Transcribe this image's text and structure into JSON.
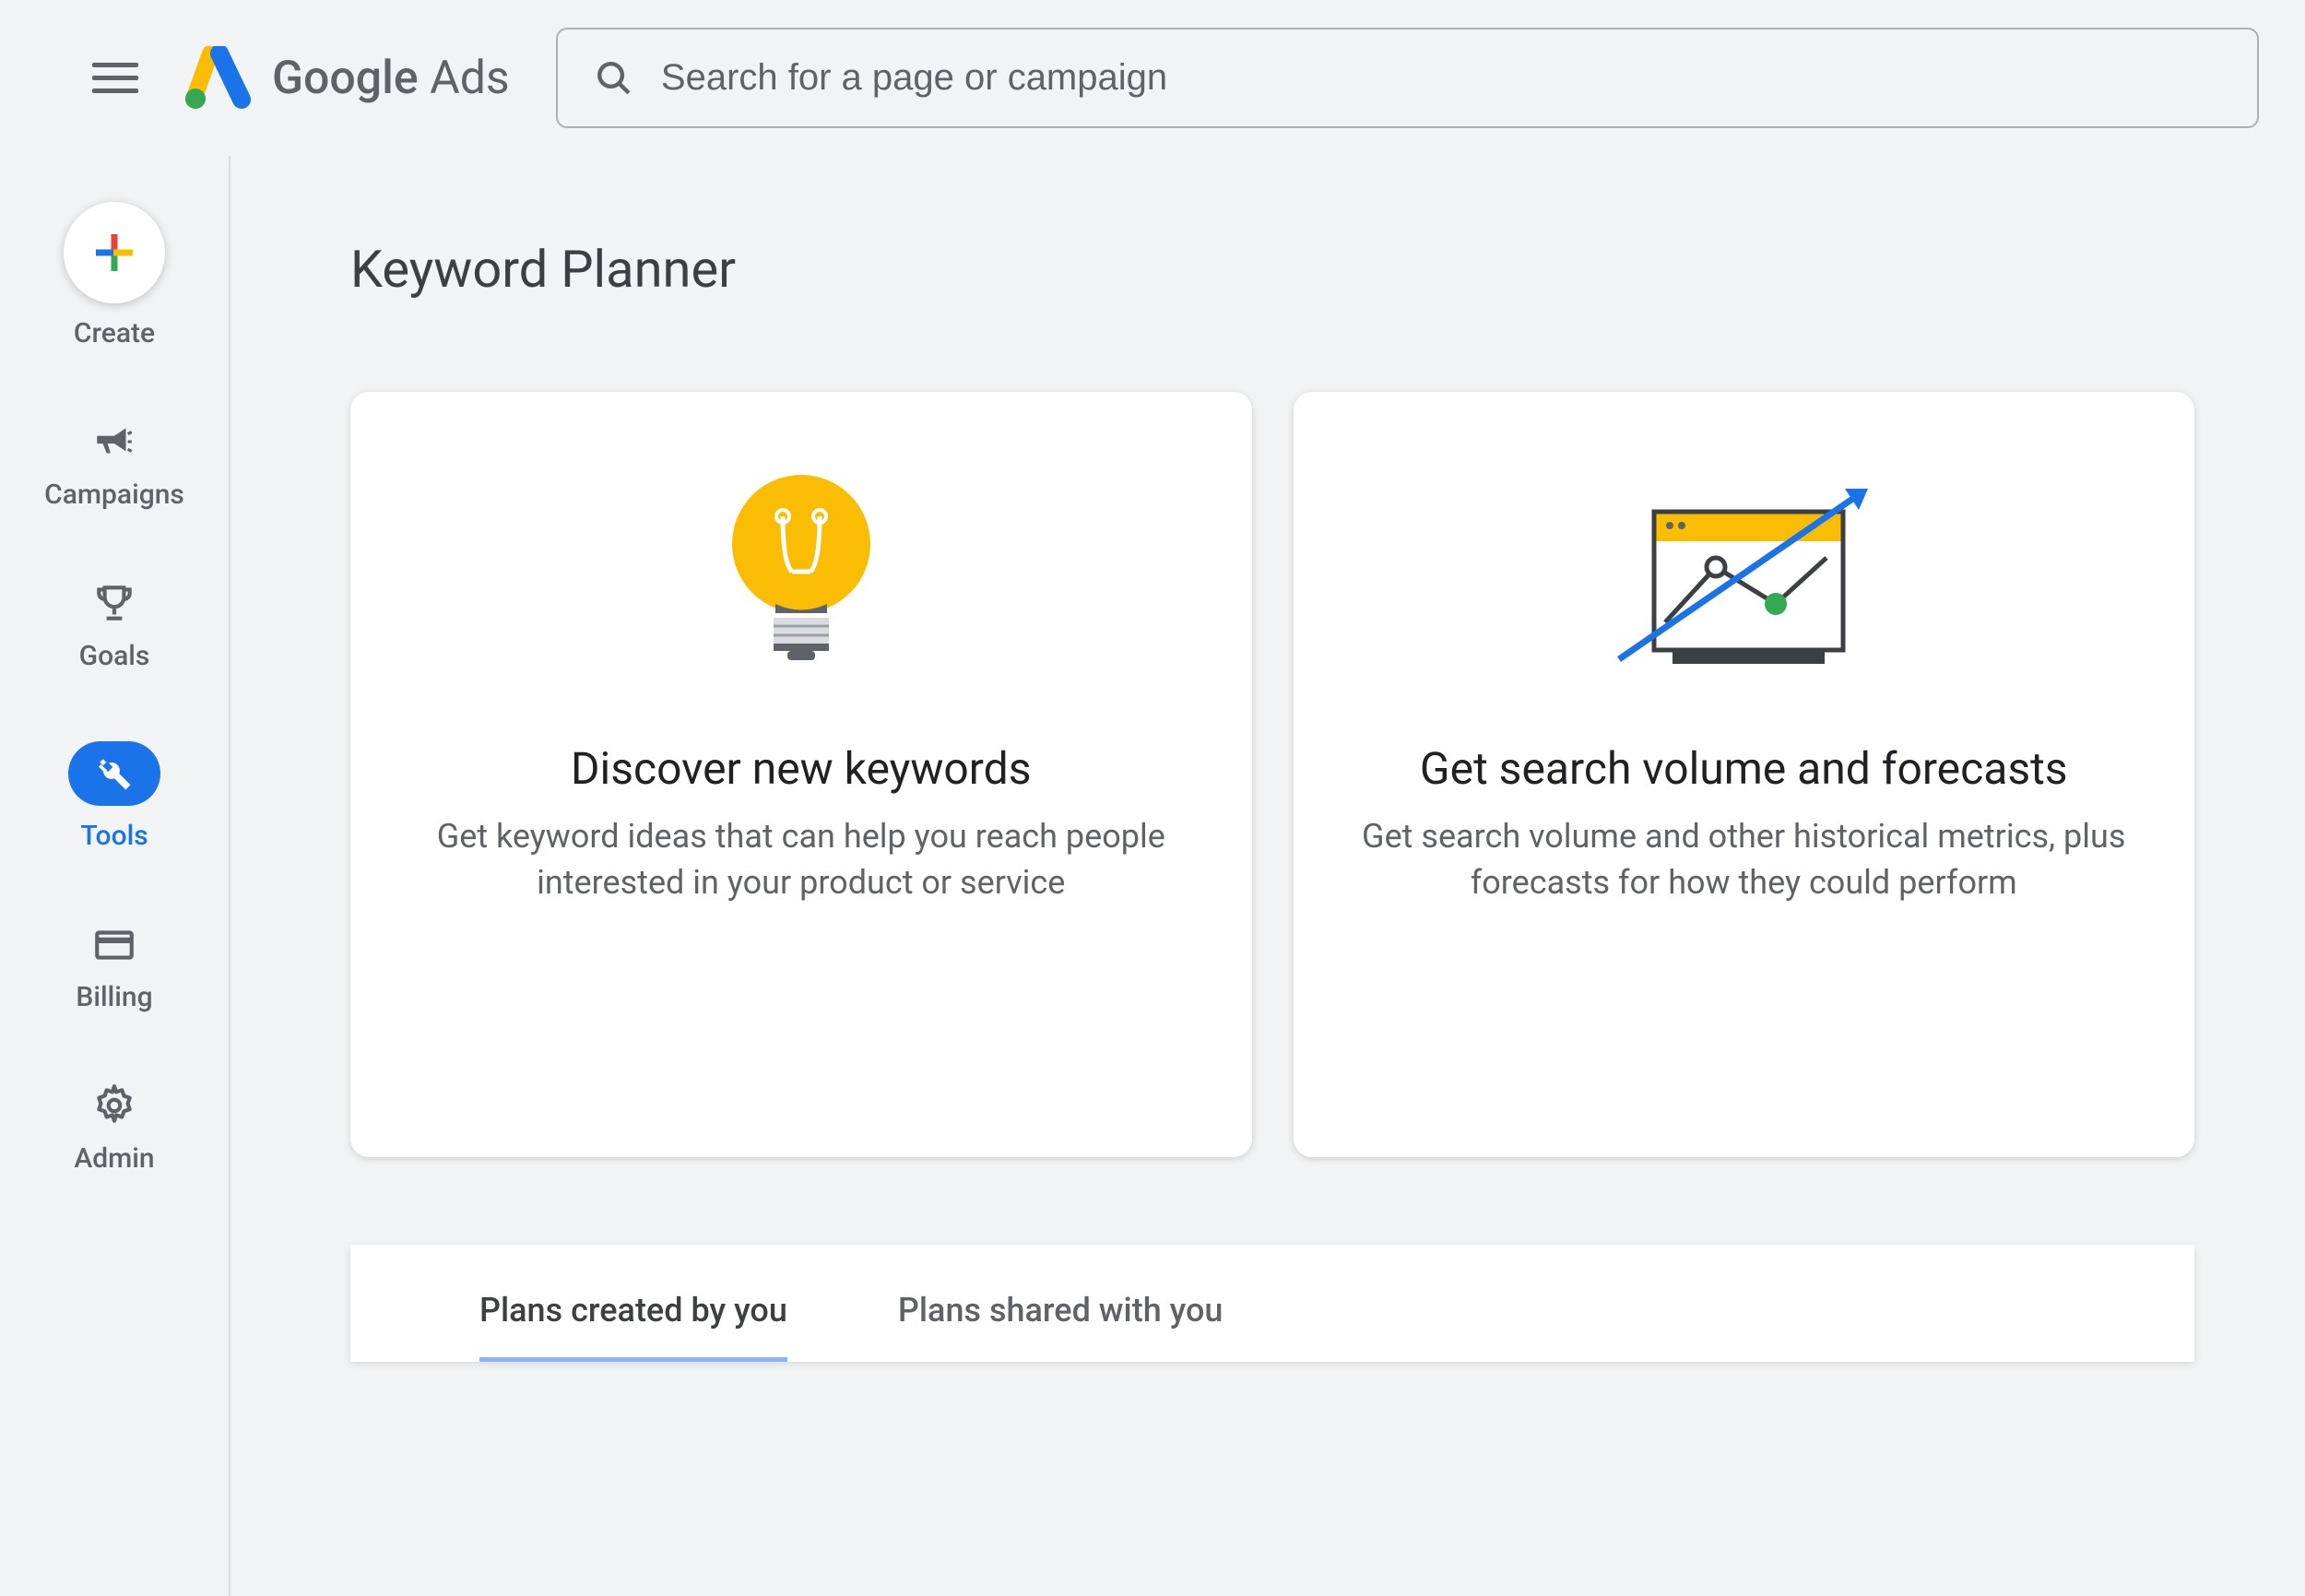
{
  "header": {
    "brand_word1": "Google",
    "brand_word2": "Ads",
    "search_placeholder": "Search for a page or campaign"
  },
  "sidebar": {
    "items": [
      {
        "label": "Create",
        "icon": "plus-icon"
      },
      {
        "label": "Campaigns",
        "icon": "megaphone-icon"
      },
      {
        "label": "Goals",
        "icon": "trophy-icon"
      },
      {
        "label": "Tools",
        "icon": "wrench-icon"
      },
      {
        "label": "Billing",
        "icon": "card-icon"
      },
      {
        "label": "Admin",
        "icon": "gear-icon"
      }
    ]
  },
  "main": {
    "title": "Keyword Planner",
    "cards": [
      {
        "title": "Discover new keywords",
        "desc": "Get keyword ideas that can help you reach people interested in your product or service"
      },
      {
        "title": "Get search volume and forecasts",
        "desc": "Get search volume and other historical metrics, plus forecasts for how they could perform"
      }
    ],
    "tabs": [
      {
        "label": "Plans created by you"
      },
      {
        "label": "Plans shared with you"
      }
    ]
  },
  "colors": {
    "accent": "#1a73e8",
    "yellow": "#fbbc04",
    "green": "#34a853",
    "red": "#ea4335",
    "gray": "#5f6368"
  }
}
